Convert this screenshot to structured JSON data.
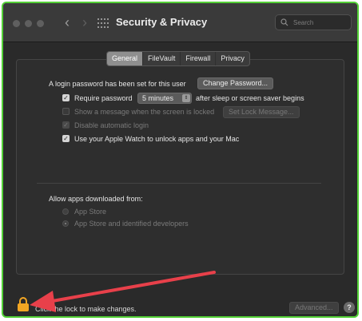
{
  "window": {
    "title": "Security & Privacy",
    "search_placeholder": "Search"
  },
  "tabs": [
    {
      "label": "General",
      "active": true
    },
    {
      "label": "FileVault",
      "active": false
    },
    {
      "label": "Firewall",
      "active": false
    },
    {
      "label": "Privacy",
      "active": false
    }
  ],
  "general": {
    "login_password_text": "A login password has been set for this user",
    "change_password_button": "Change Password...",
    "require_password_label": "Require password",
    "require_password_checked": true,
    "require_password_delay": "5 minutes",
    "require_password_suffix": "after sleep or screen saver begins",
    "show_message_label": "Show a message when the screen is locked",
    "show_message_checked": false,
    "set_lock_message_button": "Set Lock Message...",
    "disable_auto_login_label": "Disable automatic login",
    "disable_auto_login_checked": true,
    "apple_watch_label": "Use your Apple Watch to unlock apps and your Mac",
    "apple_watch_checked": true
  },
  "downloads": {
    "heading": "Allow apps downloaded from:",
    "options": [
      {
        "label": "App Store",
        "selected": false
      },
      {
        "label": "App Store and identified developers",
        "selected": true
      }
    ]
  },
  "footer": {
    "lock_text": "Click the lock to make changes.",
    "advanced_button": "Advanced...",
    "help_button": "?"
  },
  "colors": {
    "window_border": "#53d036",
    "annotation_arrow": "#e8404a",
    "lock_icon": "#f2a623"
  },
  "icons": [
    "close-dot",
    "minimize-dot",
    "zoom-dot",
    "back-chevron-icon",
    "forward-chevron-icon",
    "grid-icon",
    "search-icon",
    "lock-icon",
    "help-icon",
    "annotation-arrow"
  ]
}
